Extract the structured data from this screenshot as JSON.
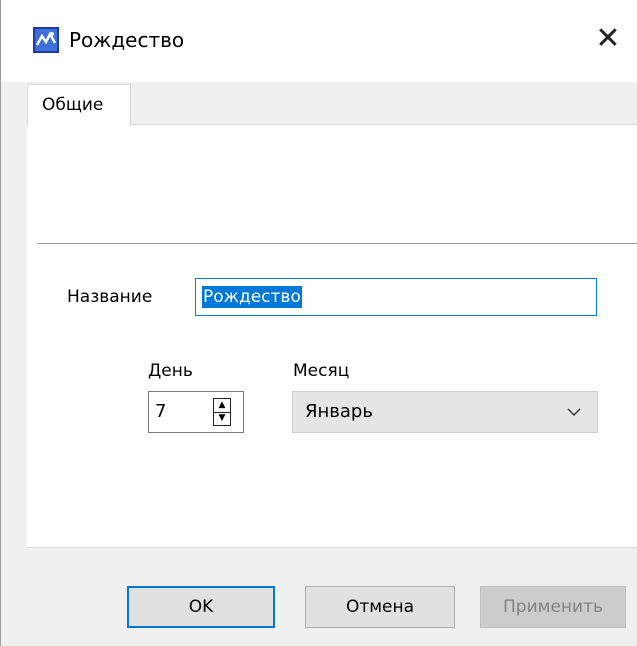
{
  "window": {
    "title": "Рождество",
    "app_icon": "app-logo-icon",
    "close_glyph": "✕"
  },
  "tabs": [
    {
      "label": "Общие"
    }
  ],
  "form": {
    "name_label": "Название",
    "name_value": "Рождество",
    "day_label": "День",
    "day_value": "7",
    "month_label": "Месяц",
    "month_value": "Январь"
  },
  "buttons": {
    "ok": "OK",
    "cancel": "Отмена",
    "apply": "Применить"
  },
  "colors": {
    "accent": "#0078d7",
    "disabled_text": "#838383"
  }
}
